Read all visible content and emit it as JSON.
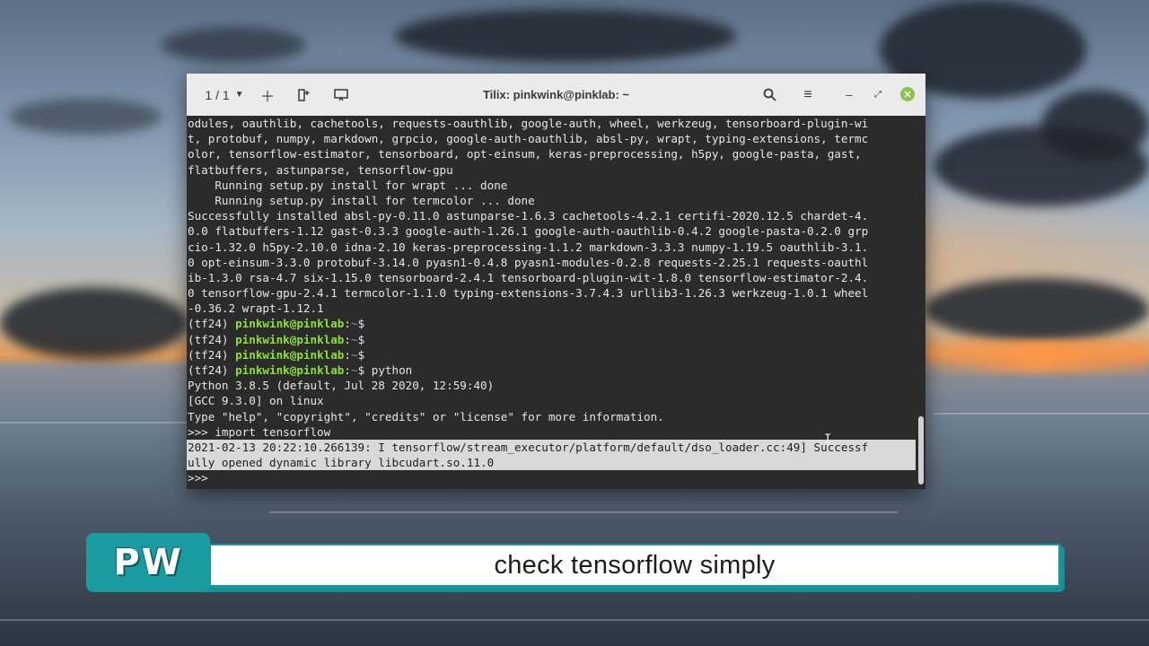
{
  "colors": {
    "prompt_user": "#8ae234",
    "path": "#729fcf",
    "terminal_bg": "#2b2b2b",
    "titlebar_bg": "#ebebeb",
    "banner_accent": "#1a9aa1",
    "close_button": "#8bc34a"
  },
  "window": {
    "title": "Tilix: pinkwink@pinklab: ~",
    "session_indicator": "1 / 1",
    "icons": [
      "chevron-down-icon",
      "plus-icon",
      "add-terminal-icon",
      "sync-input-icon",
      "search-icon",
      "hamburger-menu-icon",
      "minimize-icon",
      "maximize-icon",
      "close-icon"
    ]
  },
  "terminal": {
    "lines": [
      "odules, oauthlib, cachetools, requests-oauthlib, google-auth, wheel, werkzeug, tensorboard-plugin-wi",
      "t, protobuf, numpy, markdown, grpcio, google-auth-oauthlib, absl-py, wrapt, typing-extensions, termc",
      "olor, tensorflow-estimator, tensorboard, opt-einsum, keras-preprocessing, h5py, google-pasta, gast,",
      "flatbuffers, astunparse, tensorflow-gpu",
      "    Running setup.py install for wrapt ... done",
      "    Running setup.py install for termcolor ... done",
      "Successfully installed absl-py-0.11.0 astunparse-1.6.3 cachetools-4.2.1 certifi-2020.12.5 chardet-4.",
      "0.0 flatbuffers-1.12 gast-0.3.3 google-auth-1.26.1 google-auth-oauthlib-0.4.2 google-pasta-0.2.0 grp",
      "cio-1.32.0 h5py-2.10.0 idna-2.10 keras-preprocessing-1.1.2 markdown-3.3.3 numpy-1.19.5 oauthlib-3.1.",
      "0 opt-einsum-3.3.0 protobuf-3.14.0 pyasn1-0.4.8 pyasn1-modules-0.2.8 requests-2.25.1 requests-oauthl",
      "ib-1.3.0 rsa-4.7 six-1.15.0 tensorboard-2.4.1 tensorboard-plugin-wit-1.8.0 tensorflow-estimator-2.4.",
      "0 tensorflow-gpu-2.4.1 termcolor-1.1.0 typing-extensions-3.7.4.3 urllib3-1.26.3 werkzeug-1.0.1 wheel",
      "-0.36.2 wrapt-1.12.1"
    ],
    "prompts": [
      {
        "env": "(tf24) ",
        "user": "pinkwink@pinklab",
        "sep": ":",
        "path": "~",
        "symbol": "$",
        "cmd": ""
      },
      {
        "env": "(tf24) ",
        "user": "pinkwink@pinklab",
        "sep": ":",
        "path": "~",
        "symbol": "$",
        "cmd": ""
      },
      {
        "env": "(tf24) ",
        "user": "pinkwink@pinklab",
        "sep": ":",
        "path": "~",
        "symbol": "$",
        "cmd": ""
      },
      {
        "env": "(tf24) ",
        "user": "pinkwink@pinklab",
        "sep": ":",
        "path": "~",
        "symbol": "$",
        "cmd": " python"
      }
    ],
    "python_lines": [
      "Python 3.8.5 (default, Jul 28 2020, 12:59:40)",
      "[GCC 9.3.0] on linux",
      "Type \"help\", \"copyright\", \"credits\" or \"license\" for more information.",
      ">>> import tensorflow"
    ],
    "selected_lines": [
      "2021-02-13 20:22:10.266139: I tensorflow/stream_executor/platform/default/dso_loader.cc:49] Successf",
      "ully opened dynamic library libcudart.so.11.0"
    ],
    "current_prompt": ">>> "
  },
  "caption": {
    "logo": "PW",
    "text": "check tensorflow simply"
  }
}
